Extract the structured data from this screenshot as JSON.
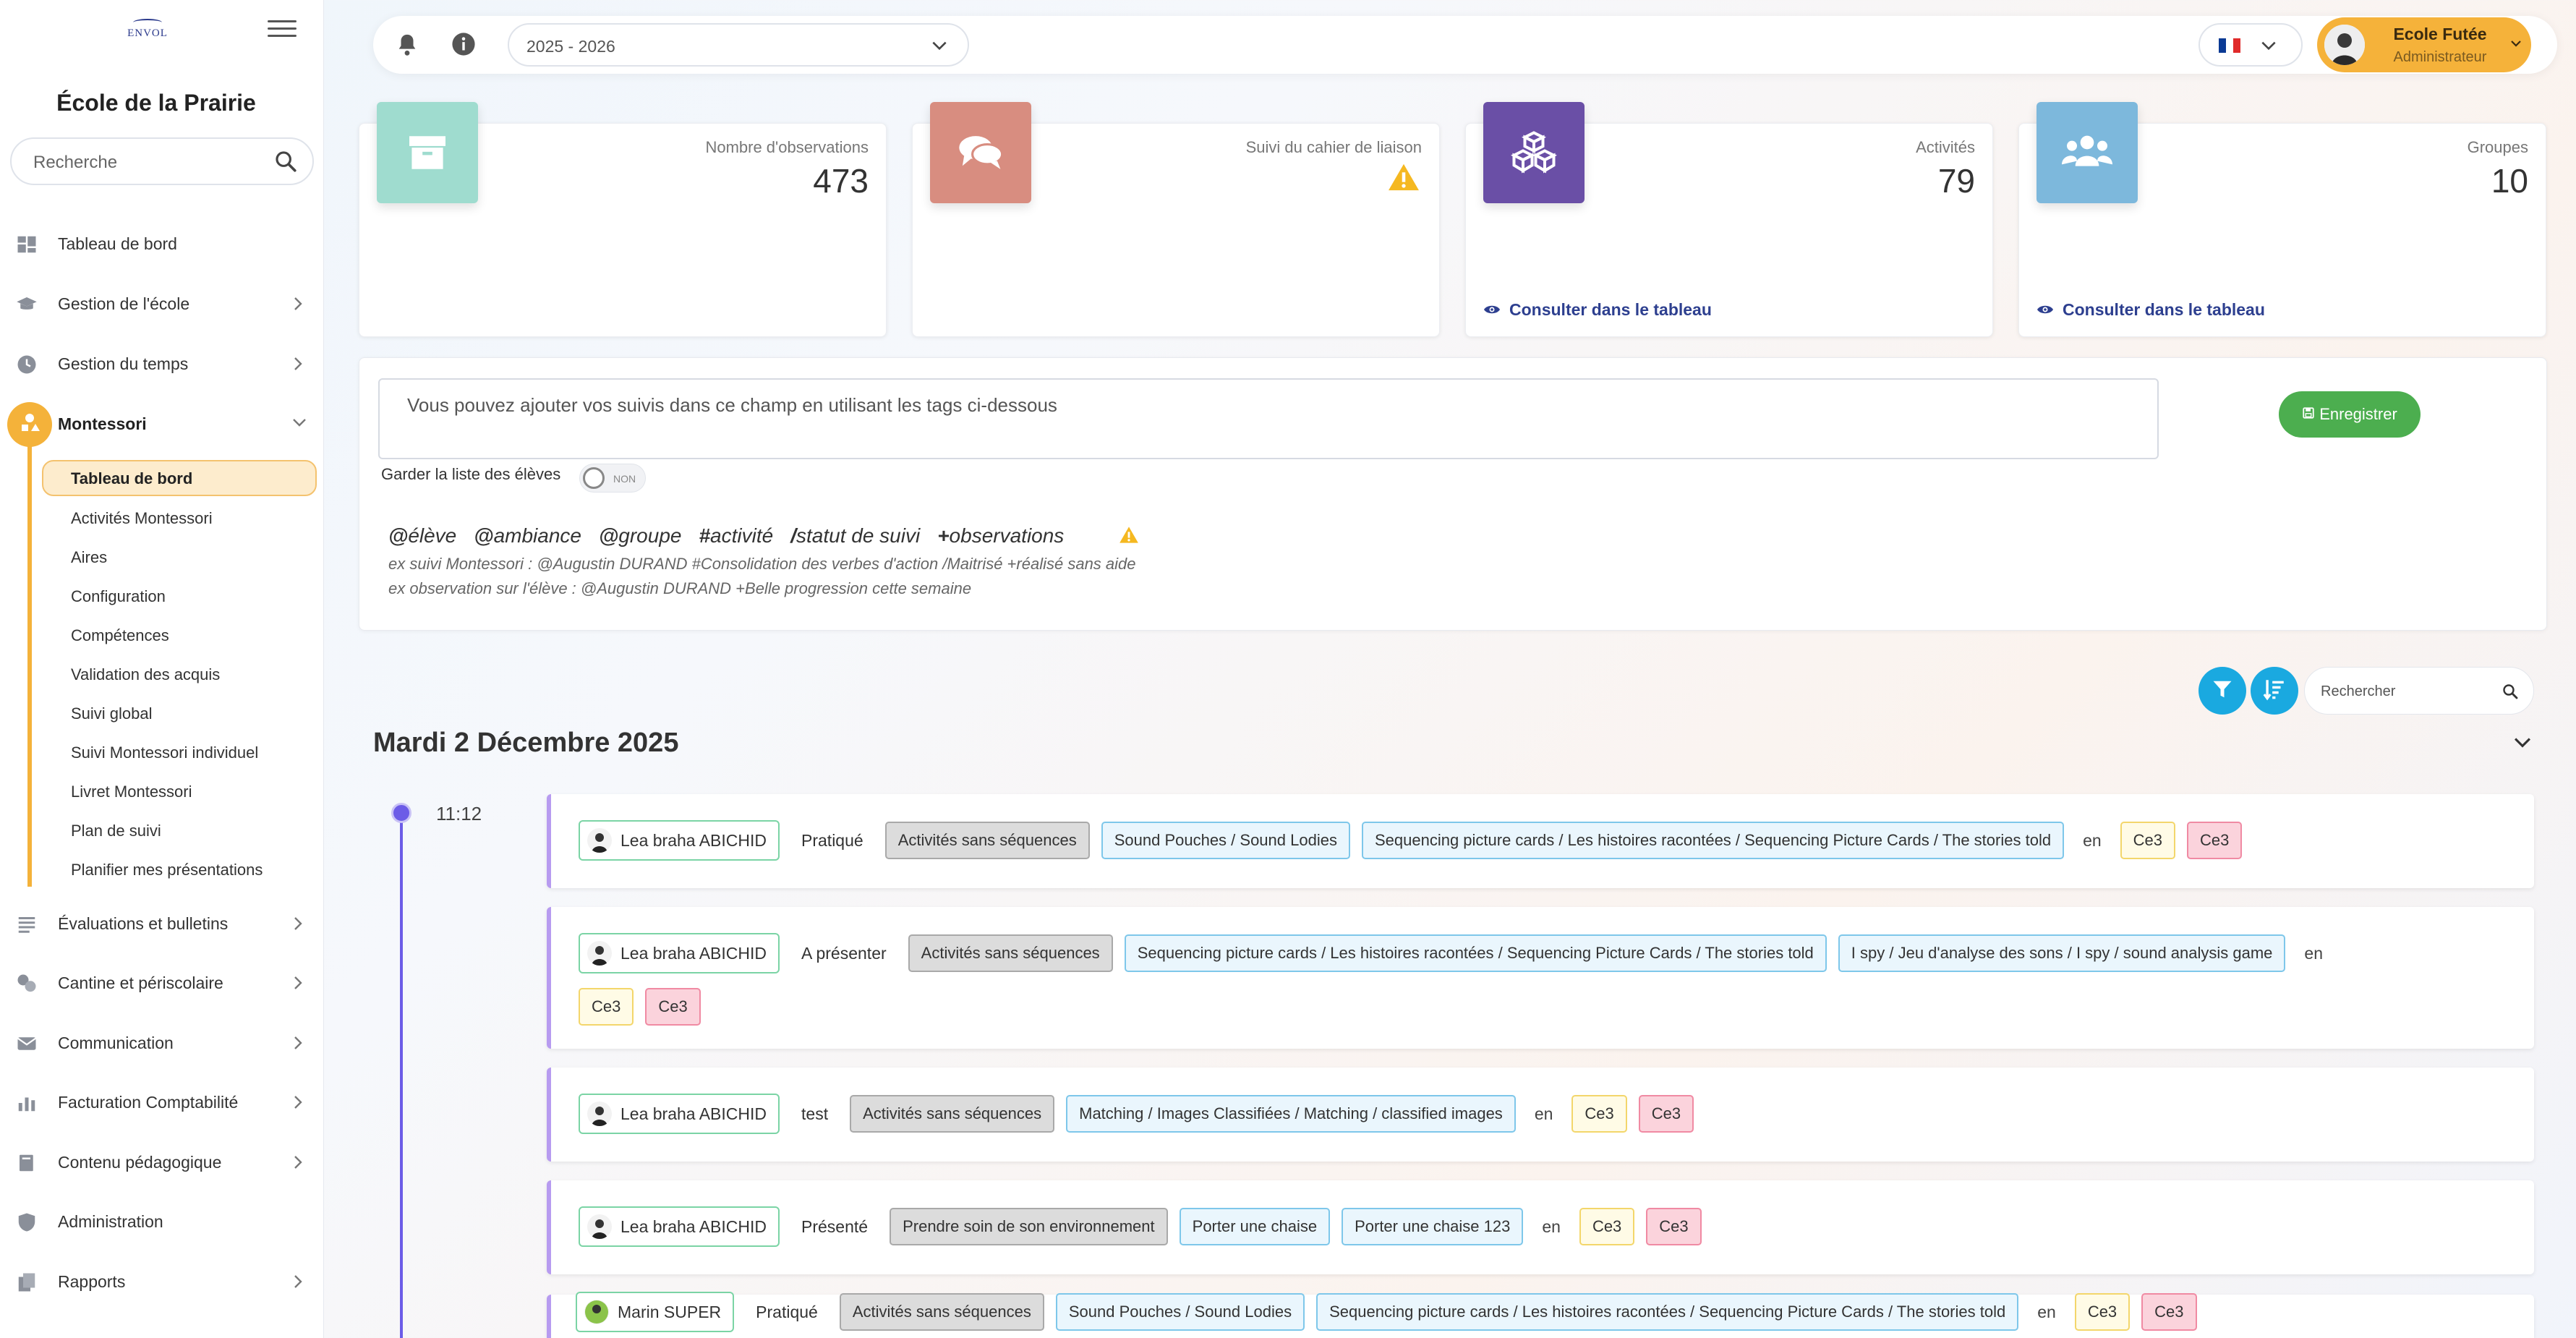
{
  "sidebar": {
    "logo_text": "ENVOL",
    "school_name": "École de la Prairie",
    "search_placeholder": "Recherche",
    "items": [
      {
        "label": "Tableau de bord"
      },
      {
        "label": "Gestion de l'école"
      },
      {
        "label": "Gestion du temps"
      },
      {
        "label": "Montessori"
      },
      {
        "label": "Évaluations et bulletins"
      },
      {
        "label": "Cantine et périscolaire"
      },
      {
        "label": "Communication"
      },
      {
        "label": "Facturation Comptabilité"
      },
      {
        "label": "Contenu pédagogique"
      },
      {
        "label": "Administration"
      },
      {
        "label": "Rapports"
      }
    ],
    "montessori_sub": [
      {
        "label": "Tableau de bord"
      },
      {
        "label": "Activités Montessori"
      },
      {
        "label": "Aires"
      },
      {
        "label": "Configuration"
      },
      {
        "label": "Compétences"
      },
      {
        "label": "Validation des acquis"
      },
      {
        "label": "Suivi global"
      },
      {
        "label": "Suivi Montessori individuel"
      },
      {
        "label": "Livret Montessori"
      },
      {
        "label": "Plan de suivi"
      },
      {
        "label": "Planifier mes présentations"
      }
    ]
  },
  "topbar": {
    "year": "2025 - 2026",
    "user_name": "Ecole Futée",
    "user_role": "Administrateur"
  },
  "stats": [
    {
      "title": "Nombre d'observations",
      "value": "473",
      "color": "#9fdccf",
      "icon": "archive-icon"
    },
    {
      "title": "Suivi du cahier de liaison",
      "value": "",
      "color": "#d88d80",
      "icon": "comments-icon"
    },
    {
      "title": "Activités",
      "value": "79",
      "color": "#6a4fa6",
      "icon": "cubes-icon",
      "link": "Consulter dans le tableau"
    },
    {
      "title": "Groupes",
      "value": "10",
      "color": "#7db8dc",
      "icon": "users-icon",
      "link": "Consulter dans le tableau"
    }
  ],
  "input_panel": {
    "placeholder": "Vous pouvez ajouter vos suivis dans ce champ en utilisant les tags ci-dessous",
    "save_label": "Enregistrer",
    "keep_label": "Garder la liste des élèves",
    "toggle_text": "NON",
    "tags": [
      {
        "sym": "@",
        "word": "élève"
      },
      {
        "sym": "@",
        "word": "ambiance"
      },
      {
        "sym": "@",
        "word": "groupe"
      },
      {
        "sym": "#",
        "word": "activité"
      },
      {
        "sym": "/",
        "word": "statut de suivi"
      },
      {
        "sym": "+",
        "word": "observations"
      }
    ],
    "example1": "ex suivi Montessori : @Augustin DURAND #Consolidation des verbes d'action /Maitrisé +réalisé sans aide",
    "example2": "ex observation sur l'élève : @Augustin DURAND +Belle progression cette semaine"
  },
  "tools": {
    "search_placeholder": "Rechercher"
  },
  "timeline": {
    "date": "Mardi 2 Décembre 2025",
    "time": "11:12",
    "en_word": "en",
    "entries": [
      {
        "student": "Lea braha ABICHID",
        "status": "Pratiqué",
        "chips": [
          {
            "t": "Activités sans séquences",
            "c": "gray"
          },
          {
            "t": "Sound Pouches / Sound Lodies",
            "c": "blue"
          },
          {
            "t": "Sequencing picture cards / Les histoires racontées / Sequencing Picture Cards / The stories told",
            "c": "blue"
          }
        ],
        "levels": [
          "Ce3",
          "Ce3"
        ]
      },
      {
        "student": "Lea braha ABICHID",
        "status": "A présenter",
        "chips": [
          {
            "t": "Activités sans séquences",
            "c": "gray"
          },
          {
            "t": "Sequencing picture cards / Les histoires racontées / Sequencing Picture Cards / The stories told",
            "c": "blue"
          },
          {
            "t": "I spy / Jeu d'analyse des sons / I spy / sound analysis game",
            "c": "blue"
          }
        ],
        "levels": [
          "Ce3",
          "Ce3"
        ]
      },
      {
        "student": "Lea braha ABICHID",
        "status": "test",
        "chips": [
          {
            "t": "Activités sans séquences",
            "c": "gray"
          },
          {
            "t": "Matching / Images Classifiées / Matching / classified images",
            "c": "blue"
          }
        ],
        "levels": [
          "Ce3",
          "Ce3"
        ]
      },
      {
        "student": "Lea braha ABICHID",
        "status": "Présenté",
        "chips": [
          {
            "t": "Prendre soin de son environnement",
            "c": "gray"
          },
          {
            "t": "Porter une chaise",
            "c": "blue"
          },
          {
            "t": "Porter une chaise 123",
            "c": "blue"
          }
        ],
        "levels": [
          "Ce3",
          "Ce3"
        ]
      },
      {
        "student": "Marin SUPER",
        "status": "Pratiqué",
        "chips": [
          {
            "t": "Activités sans séquences",
            "c": "gray"
          },
          {
            "t": "Sound Pouches / Sound Lodies",
            "c": "blue"
          },
          {
            "t": "Sequencing picture cards / Les histoires racontées / Sequencing Picture Cards / The stories told",
            "c": "blue"
          }
        ],
        "levels": [
          "Ce3",
          "Ce3"
        ]
      }
    ]
  }
}
